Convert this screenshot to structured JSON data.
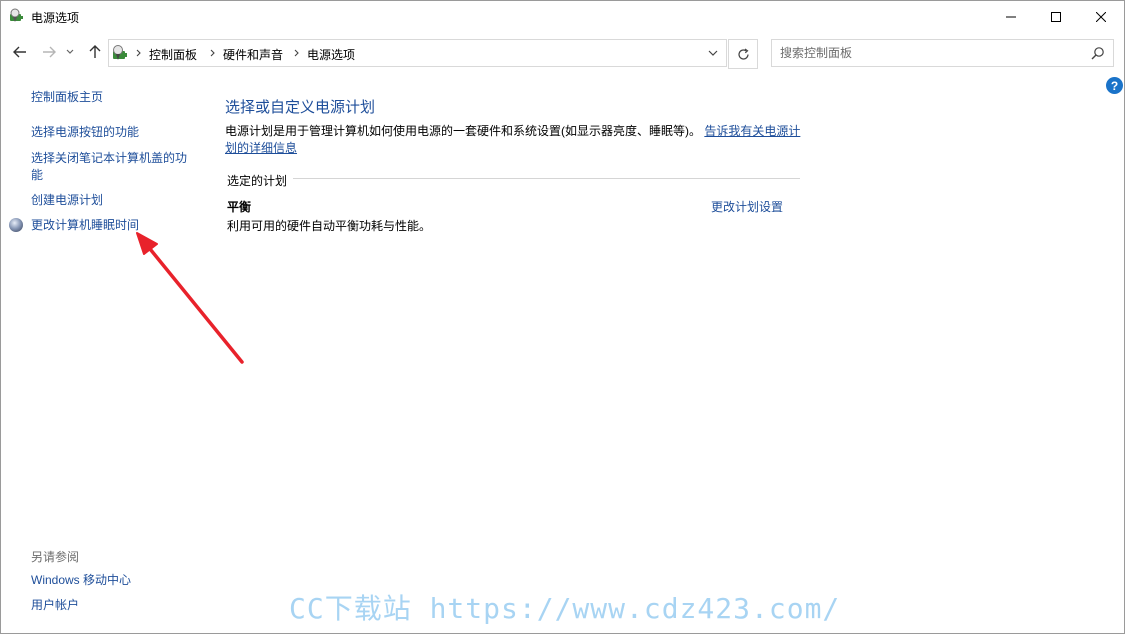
{
  "window": {
    "title": "电源选项"
  },
  "address": {
    "crumbs": [
      "控制面板",
      "硬件和声音",
      "电源选项"
    ]
  },
  "search": {
    "placeholder": "搜索控制面板"
  },
  "help_label": "?",
  "sidebar": {
    "items": [
      {
        "label": "控制面板主页"
      },
      {
        "label": "选择电源按钮的功能"
      },
      {
        "label": "选择关闭笔记本计算机盖的功"
      },
      {
        "label": "能"
      },
      {
        "label": "创建电源计划"
      },
      {
        "label": "更改计算机睡眠时间"
      }
    ],
    "see_also_title": "另请参阅",
    "see_also": [
      {
        "label": "Windows 移动中心"
      },
      {
        "label": "用户帐户"
      }
    ]
  },
  "main": {
    "title": "选择或自定义电源计划",
    "description": "电源计划是用于管理计算机如何使用电源的一套硬件和系统设置(如显示器亮度、睡眠等)。",
    "description_link": "告诉我有关电源计",
    "description_link_2": "划的详细信息",
    "section_label": "选定的计划",
    "plan": {
      "name": "平衡",
      "description": "利用可用的硬件自动平衡功耗与性能。",
      "change_link": "更改计划设置"
    }
  },
  "watermark": "CC下载站 https://www.cdz423.com/",
  "colors": {
    "link": "#1e4e9a",
    "annotation_arrow": "#e8222b",
    "watermark": "#9fd0f2"
  }
}
